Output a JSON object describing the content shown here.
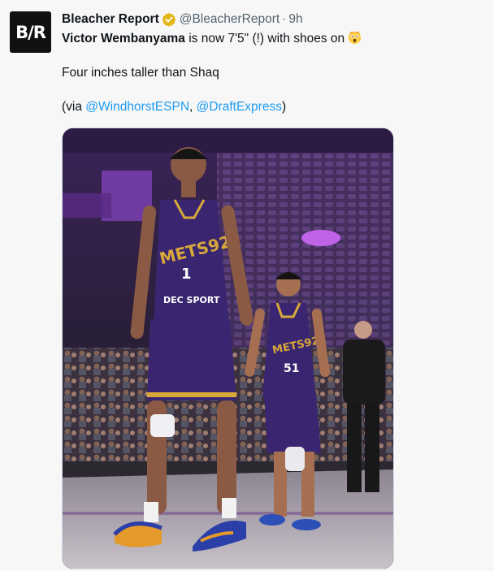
{
  "tweet": {
    "avatar_text": "B/R",
    "author_name": "Bleacher Report",
    "verified_icon": "verified-badge-gold",
    "handle": "@BleacherReport",
    "separator": "·",
    "timestamp": "9h",
    "line1_bold": "Victor Wembanyama",
    "line1_rest": " is now 7'5\" (!) with shoes on",
    "line1_emoji": "shocked-face-emoji",
    "line2": "Four inches taller than Shaq",
    "via_prefix": "(via ",
    "mention1": "@WindhorstESPN",
    "via_sep": ", ",
    "mention2": "@DraftExpress",
    "via_suffix": ")"
  },
  "image": {
    "jersey1_team": "METS92",
    "jersey1_number": "1",
    "jersey2_team": "METS92",
    "jersey2_number": "51",
    "jersey_sponsor": "DEC SPORT",
    "colors": {
      "jersey": "#3a2670",
      "trim": "#d8a83a",
      "court": "#b9b2bd"
    }
  }
}
